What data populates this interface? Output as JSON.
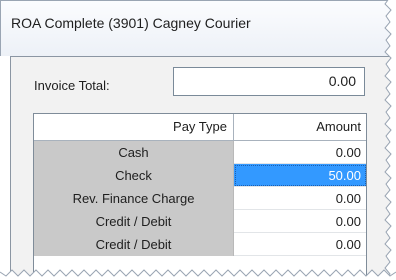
{
  "window": {
    "title": "ROA Complete (3901) Cagney Courier"
  },
  "invoice_total": {
    "label": "Invoice Total:",
    "value": "0.00"
  },
  "grid": {
    "columns": [
      "Pay Type",
      "Amount"
    ],
    "rows": [
      {
        "pay_type": "Cash",
        "amount": "0.00",
        "selected": false
      },
      {
        "pay_type": "Check",
        "amount": "50.00",
        "selected": true
      },
      {
        "pay_type": "Rev. Finance Charge",
        "amount": "0.00",
        "selected": false
      },
      {
        "pay_type": "Credit / Debit",
        "amount": "0.00",
        "selected": false
      },
      {
        "pay_type": "Credit / Debit",
        "amount": "0.00",
        "selected": false
      }
    ]
  },
  "colors": {
    "selection": "#3399ff",
    "pay_type_bg": "#c9c9c9",
    "panel_bg": "#f2f2f2"
  }
}
